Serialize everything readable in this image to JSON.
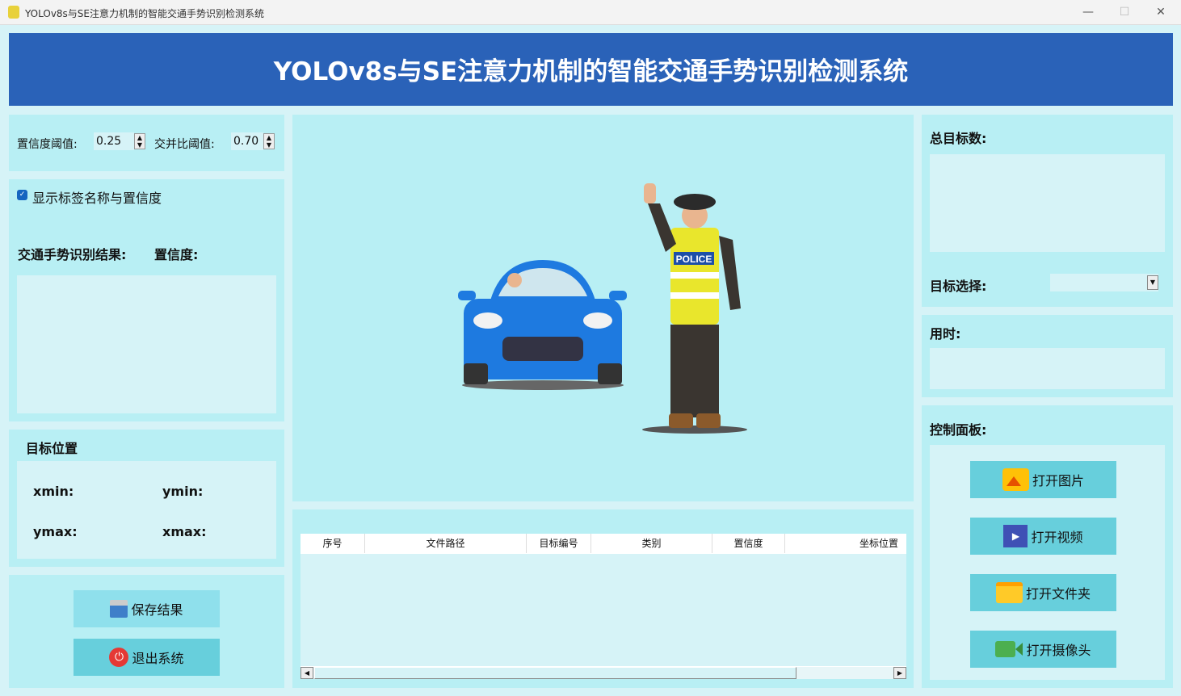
{
  "window": {
    "title": "YOLOv8s与SE注意力机制的智能交通手势识别检测系统",
    "minimize": "—",
    "maximize": "☐",
    "close": "✕"
  },
  "header": {
    "title": "YOLOv8s与SE注意力机制的智能交通手势识别检测系统"
  },
  "params": {
    "conf_label": "置信度阈值:",
    "conf_value": "0.25",
    "iou_label": "交并比阈值:",
    "iou_value": "0.70"
  },
  "results": {
    "show_label": "显示标签名称与置信度",
    "show_checked": true,
    "gesture_label": "交通手势识别结果:",
    "confidence_label": "置信度:"
  },
  "position": {
    "title": "目标位置",
    "xmin": "xmin:",
    "ymin": "ymin:",
    "ymax": "ymax:",
    "xmax": "xmax:"
  },
  "actions": {
    "save": "保存结果",
    "exit": "退出系统"
  },
  "table": {
    "columns": [
      "序号",
      "文件路径",
      "目标编号",
      "类别",
      "置信度",
      "坐标位置"
    ],
    "rows": []
  },
  "right": {
    "total_label": "总目标数:",
    "select_label": "目标选择:",
    "time_label": "用时:",
    "control_label": "控制面板:"
  },
  "controls": {
    "open_image": "打开图片",
    "open_video": "打开视频",
    "open_folder": "打开文件夹",
    "open_camera": "打开摄像头"
  },
  "illustration": {
    "badge": "POLICE"
  }
}
